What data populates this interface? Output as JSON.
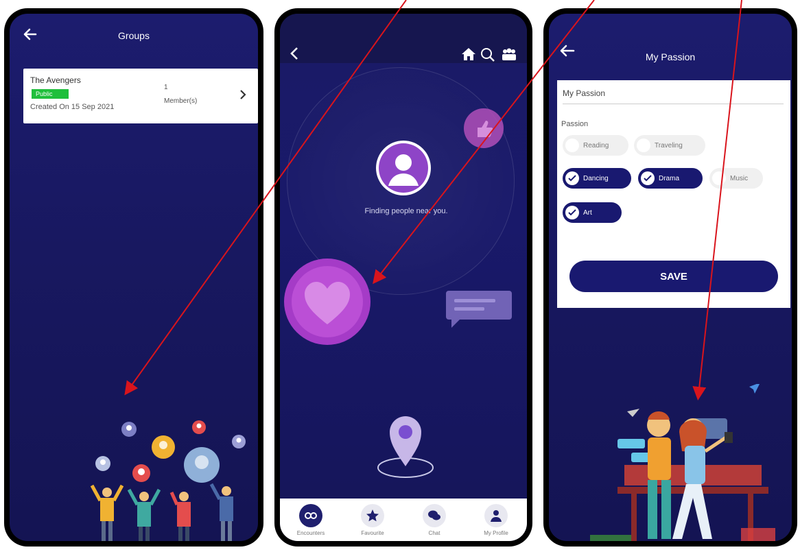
{
  "phone1": {
    "title": "Groups",
    "group": {
      "name": "The Avengers",
      "status": "Public",
      "created": "Created On 15 Sep 2021",
      "member_count": "1",
      "member_label": "Member(s)"
    }
  },
  "phone2": {
    "finding_text": "Finding people near you.",
    "nav": [
      {
        "label": "Encounters",
        "icon": "encounter-icon"
      },
      {
        "label": "Favourite",
        "icon": "star-icon"
      },
      {
        "label": "Chat",
        "icon": "chat-icon"
      },
      {
        "label": "My Profile",
        "icon": "profile-icon"
      }
    ]
  },
  "phone3": {
    "title": "My Passion",
    "field_value": "My Passion",
    "subtitle": "Passion",
    "chips": [
      {
        "label": "Reading",
        "selected": false
      },
      {
        "label": "Traveling",
        "selected": false
      },
      {
        "label": "Dancing",
        "selected": true
      },
      {
        "label": "Drama",
        "selected": true
      },
      {
        "label": "Music",
        "selected": false
      },
      {
        "label": "Art",
        "selected": true
      }
    ],
    "save_label": "SAVE"
  },
  "colors": {
    "background": "#1a1a66",
    "accent": "#191970",
    "public_badge": "#1fbf3c",
    "arrow": "#d9141c"
  }
}
